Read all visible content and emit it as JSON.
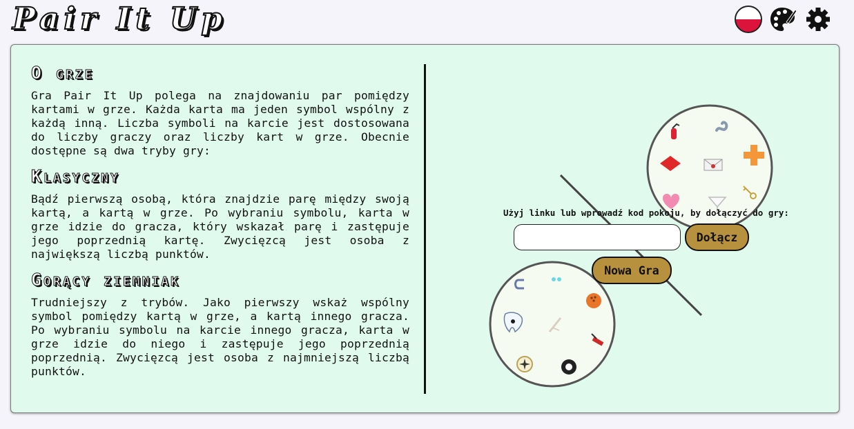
{
  "app": {
    "logo": "Pair It Up"
  },
  "header": {
    "language_flag": "poland-flag-icon",
    "theme_icon": "palette-icon",
    "settings_icon": "gear-icon"
  },
  "about": {
    "title": "O grze",
    "intro": "Gra Pair It Up polega na znajdowaniu par pomiędzy kartami w grze. Każda karta ma jeden symbol wspólny z każdą inną. Liczba symboli na karcie jest dostosowana do liczby graczy oraz liczby kart w grze. Obecnie dostępne są dwa tryby gry:",
    "modes": [
      {
        "title": "Klasyczny",
        "description": "Bądź pierwszą osobą, która znajdzie parę między swoją kartą, a kartą w grze. Po wybraniu symbolu, karta w grze idzie do gracza, który wskazał parę i zastępuje jego poprzednią kartę. Zwycięzcą jest osoba z największą liczbą punktów."
      },
      {
        "title": "Gorący ziemniak",
        "description": "Trudniejszy z trybów. Jako pierwszy wskaż wspólny symbol pomiędzy kartą w grze, a kartą innego gracza. Po wybraniu symbolu na karcie innego gracza, karta w grze idzie do niego i zastępuje jego poprzednią poprzednią. Zwycięzcą jest osoba z najmniejszą liczbą punktów."
      }
    ]
  },
  "join": {
    "label": "Użyj linku lub wprowadź kod pokoju, by dołączyć do gry:",
    "code_value": "",
    "code_placeholder": "",
    "join_button": "Dołącz",
    "new_game_button": "Nowa Gra"
  },
  "cards": {
    "top": [
      "fire-extinguisher-icon",
      "worm-icon",
      "diamond-icon",
      "envelope-icon",
      "cross-icon",
      "heart-icon",
      "cocktail-glass-icon",
      "key-icon"
    ],
    "bottom": [
      "magnet-icon",
      "molecule-icon",
      "bowling-ball-icon",
      "tooth-icon",
      "bandage-icon",
      "swiss-knife-icon",
      "compass-icon",
      "eight-ball-icon"
    ]
  },
  "colors": {
    "panel_bg": "#e0fbee",
    "button_bg": "#b8913e",
    "page_bg": "#f4f4fa"
  }
}
